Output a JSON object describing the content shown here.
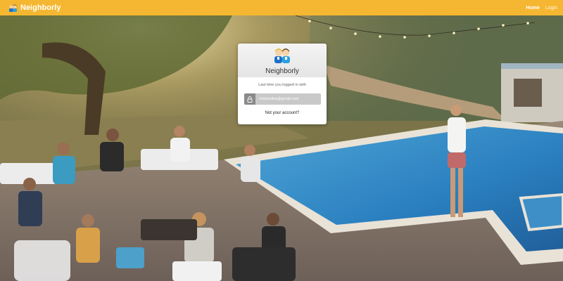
{
  "navbar": {
    "brand_name": "Neighborly",
    "brand_icon": "two-people-icon",
    "links": [
      {
        "label": "Home",
        "active": true
      },
      {
        "label": "Login",
        "active": false
      }
    ],
    "color": "#f5b731"
  },
  "login_card": {
    "logo_icon": "two-people-icon",
    "title": "Neighborly",
    "last_logged_text": "Last time you logged in with",
    "account_icon": "lock-icon",
    "account_email": "mtarbutkis@gmail.com",
    "not_account_link": "Not your account?"
  }
}
